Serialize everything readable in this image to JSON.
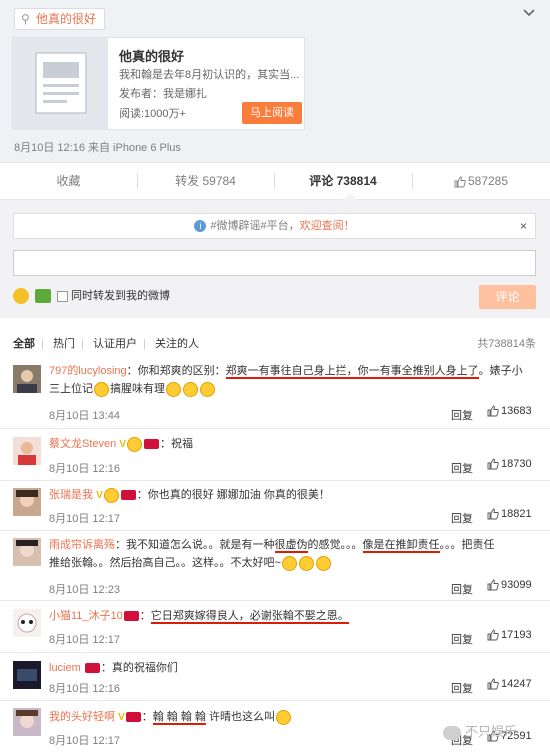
{
  "card": {
    "tag": "他真的很好",
    "title": "他真的很好",
    "desc": "我和翰是去年8月初认识的，其实当...",
    "publisher": "发布者：我是娜扎",
    "reads": "阅读:1000万+",
    "read_button": "马上阅读"
  },
  "meta": "8月10日 12:16 来自 iPhone 6 Plus",
  "actions": {
    "favorite": "收藏",
    "repost": "转发 59784",
    "comment": "评论 738814",
    "like": "587285"
  },
  "notice": {
    "prefix": "#微博辟谣#平台，",
    "welcome": "欢迎查阅！",
    "close": "×"
  },
  "compose": {
    "sync_label": "同时转发到我的微博",
    "submit": "评论"
  },
  "filters": {
    "all": "全部",
    "hot": "热门",
    "verified": "认证用户",
    "following": "关注的人",
    "total": "共738814条"
  },
  "comments": [
    {
      "user": "797的lucylosing",
      "text_a": "：你和郑爽的区别：",
      "text_b": "郑爽一有事往自己身上拦，你一有事全推别人身上了",
      "text_c": "。婊子小",
      "text_line2": "三上位记",
      "text_line2b": "搞腥味有理",
      "time": "8月10日 13:44",
      "reply": "回复",
      "likes": "13683"
    },
    {
      "user": "蔡文龙Steven",
      "badge": "V",
      "text": "：祝福",
      "time": "8月10日 12:16",
      "reply": "回复",
      "likes": "18730"
    },
    {
      "user": "张瑞是我",
      "badge": "V",
      "text": "：你也真的很好 娜娜加油 你真的很美！",
      "time": "8月10日 12:17",
      "reply": "回复",
      "likes": "18821"
    },
    {
      "user": "雨成帘诉离殇",
      "text_a": "：我不知道怎么说。。就是有一种",
      "text_b": "很虚伪",
      "text_c": "的感觉。。。",
      "text_d": "像是在推卸责任",
      "text_e": "。。。把责任",
      "text_line2": "推给张翰。。然后抬高自己。。这样。。不太好吧~",
      "time": "8月10日 12:23",
      "reply": "回复",
      "likes": "93099"
    },
    {
      "user": "小猫11_沐子10",
      "text_a": "：",
      "text_b": "它日郑爽嫁得良人，必谢张翰不娶之恩。",
      "time": "8月10日 12:17",
      "reply": "回复",
      "likes": "17193"
    },
    {
      "user": "luciem",
      "text": "：真的祝福你们",
      "time": "8月10日 12:16",
      "reply": "回复",
      "likes": "14247"
    },
    {
      "user": "我的头好轻啊",
      "badge": "V",
      "text_a": "：",
      "text_b": "翰 翰 翰 翰",
      "text_c": " 许晴也这么叫",
      "time": "8月10日 12:17",
      "reply": "回复",
      "likes": "72591"
    }
  ],
  "watermark": "不只娱乐"
}
